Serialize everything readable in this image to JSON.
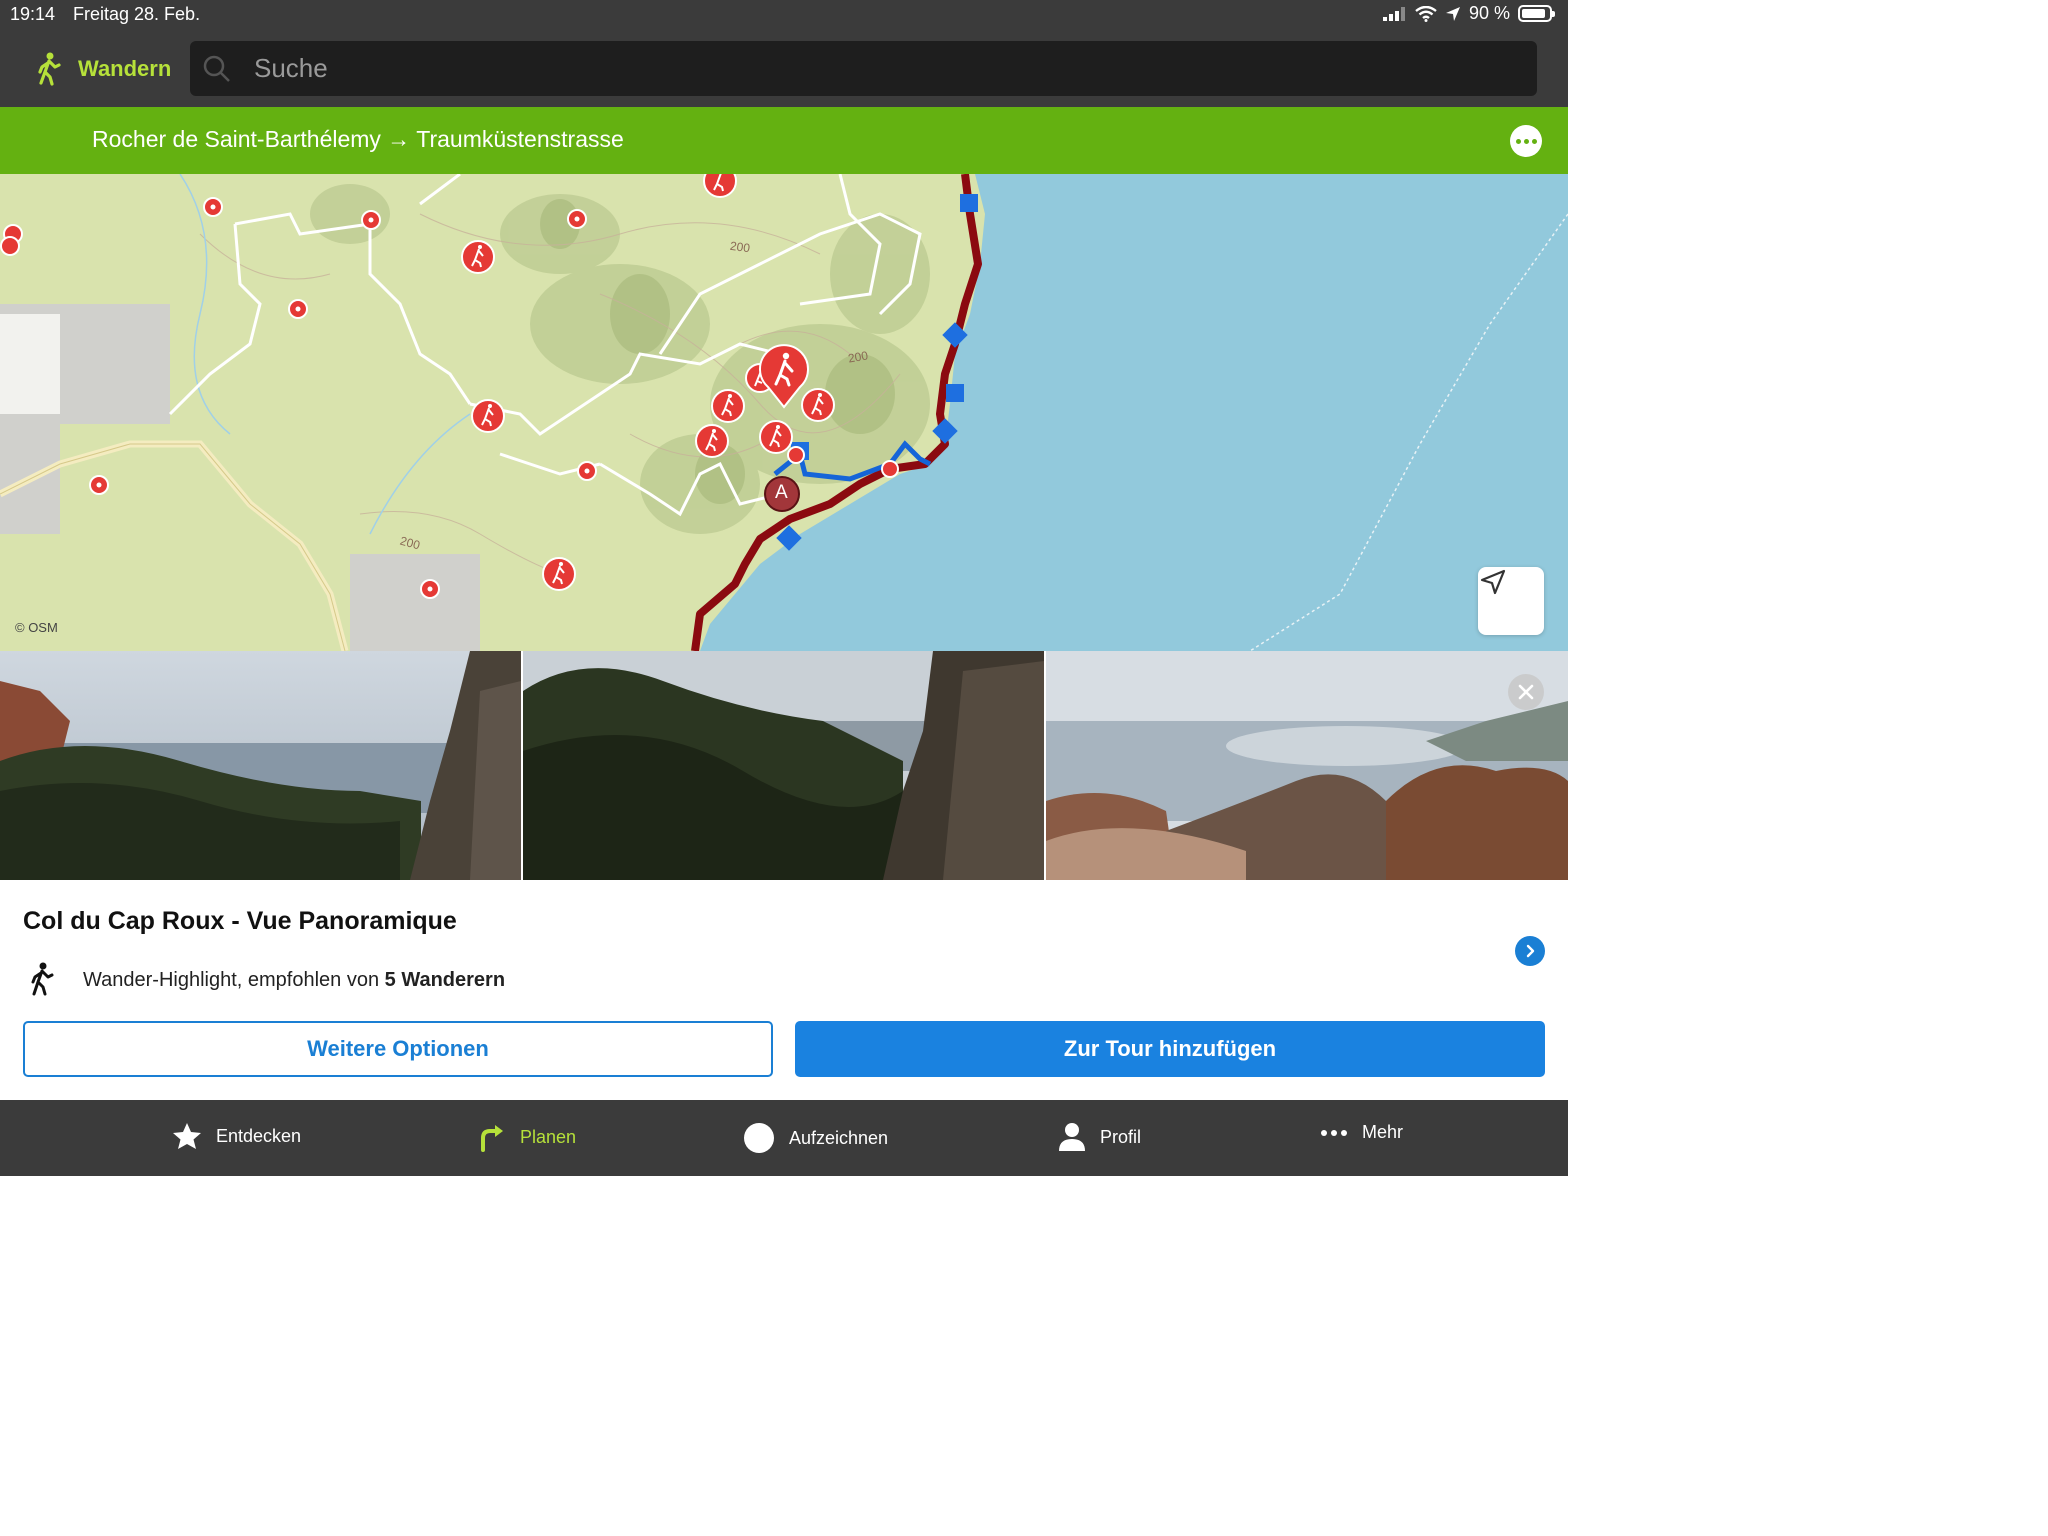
{
  "status_bar": {
    "time": "19:14",
    "date": "Freitag 28. Feb.",
    "battery": "90 %"
  },
  "header": {
    "sport_label": "Wandern",
    "search_placeholder": "Suche"
  },
  "route_bar": {
    "title": "Rocher de Saint-Barthélemy → Traumküstenstrasse"
  },
  "map": {
    "attribution": "© OSM",
    "contour_labels": [
      "200",
      "200",
      "200"
    ],
    "waypoint_label": "A"
  },
  "highlight": {
    "title": "Col du Cap Roux - Vue Panoramique",
    "desc_prefix": "Wander-Highlight, empfohlen von ",
    "desc_bold": "5 Wanderern"
  },
  "buttons": {
    "more_options": "Weitere Optionen",
    "add_to_tour": "Zur Tour hinzufügen"
  },
  "tabs": [
    {
      "label": "Entdecken",
      "icon": "star-icon"
    },
    {
      "label": "Planen",
      "icon": "plan-arrow-icon"
    },
    {
      "label": "Aufzeichnen",
      "icon": "record-icon"
    },
    {
      "label": "Profil",
      "icon": "person-icon"
    },
    {
      "label": "Mehr",
      "icon": "more-dots-icon"
    }
  ],
  "colors": {
    "accent_green": "#64b111",
    "sport_green": "#b6e13a",
    "primary_blue": "#1a82e0",
    "route_red": "#8b0a10",
    "sea": "#92c9dc"
  }
}
